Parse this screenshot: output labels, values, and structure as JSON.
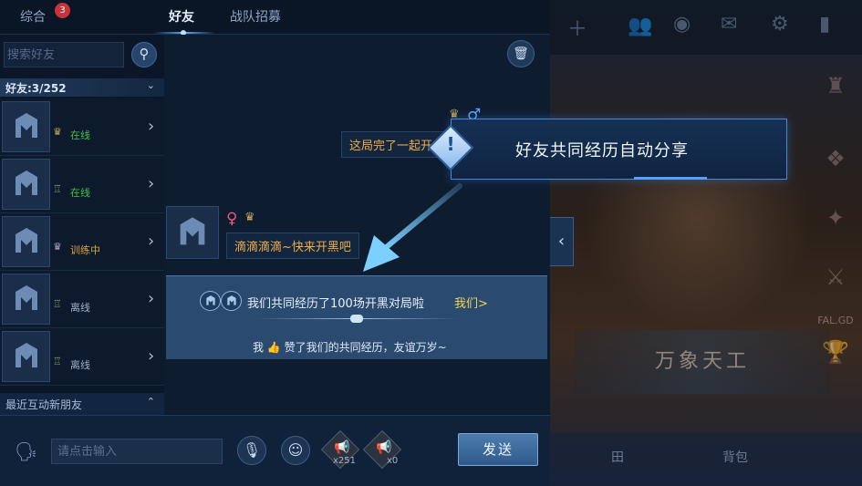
{
  "tabs": {
    "general": "综合",
    "general_badge": "3",
    "friends": "好友",
    "recruit": "战队招募"
  },
  "friends_panel": {
    "search_placeholder": "搜索好友",
    "count_label": "好友:3/252",
    "recent_label": "最近互动新朋友",
    "items": [
      {
        "status": "在线",
        "status_type": "online"
      },
      {
        "status": "在线",
        "status_type": "online"
      },
      {
        "status": "训练中",
        "status_type": "training"
      },
      {
        "status": "离线",
        "status_type": "offline"
      },
      {
        "status": "离线",
        "status_type": "offline"
      }
    ]
  },
  "chat": {
    "self_message": "这局完了一起开",
    "peer_message": "滴滴滴滴~快来开黑吧"
  },
  "experience_card": {
    "title": "我们共同经历了100场开黑对局啦",
    "link": "我们>",
    "line_prefix": "我",
    "line_suffix": "赞了我们的共同经历，友谊万岁~"
  },
  "input_bar": {
    "placeholder": "请点击输入",
    "horn_count_1": "x251",
    "horn_count_2": "x0",
    "send_label": "发送"
  },
  "callout": {
    "text": "好友共同经历自动分享"
  },
  "background": {
    "banner_text": "万象天工",
    "bottom_left": "田",
    "bottom_right": "背包",
    "side_label": "FAL.GD"
  },
  "colors": {
    "accent": "#5ab0ff",
    "online": "#3bc24a",
    "training": "#d9a63d",
    "highlight": "#f5d456",
    "message": "#f0ab48"
  }
}
